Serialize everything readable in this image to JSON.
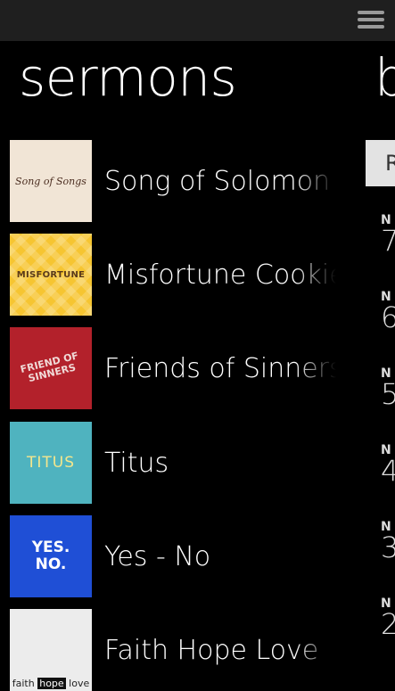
{
  "header": {
    "menu_icon": "hamburger-menu-icon"
  },
  "page": {
    "title": "sermons",
    "next_title": "b"
  },
  "sermons": [
    {
      "label": "Song of Solomon",
      "thumb_text": "Song of Songs"
    },
    {
      "label": "Misfortune Cookie",
      "thumb_text": "MISFORTUNE"
    },
    {
      "label": "Friends of Sinners",
      "thumb_text": "FRIEND OF SINNERS"
    },
    {
      "label": "Titus",
      "thumb_text": "TITUS"
    },
    {
      "label": "Yes - No",
      "thumb_text_1": "YES.",
      "thumb_text_2": "NO."
    },
    {
      "label": "Faith Hope Love",
      "thumb_text_1": "faith",
      "thumb_text_2": "hope",
      "thumb_text_3": "love"
    }
  ],
  "peek": {
    "button_letter": "R",
    "rows": [
      {
        "small": "N",
        "big": "7"
      },
      {
        "small": "N",
        "big": "6"
      },
      {
        "small": "N",
        "big": "5"
      },
      {
        "small": "N",
        "big": "4"
      },
      {
        "small": "N",
        "big": "3"
      },
      {
        "small": "N",
        "big": "2"
      }
    ]
  },
  "colors": {
    "background": "#000000",
    "appbar": "#1f1f1f"
  }
}
